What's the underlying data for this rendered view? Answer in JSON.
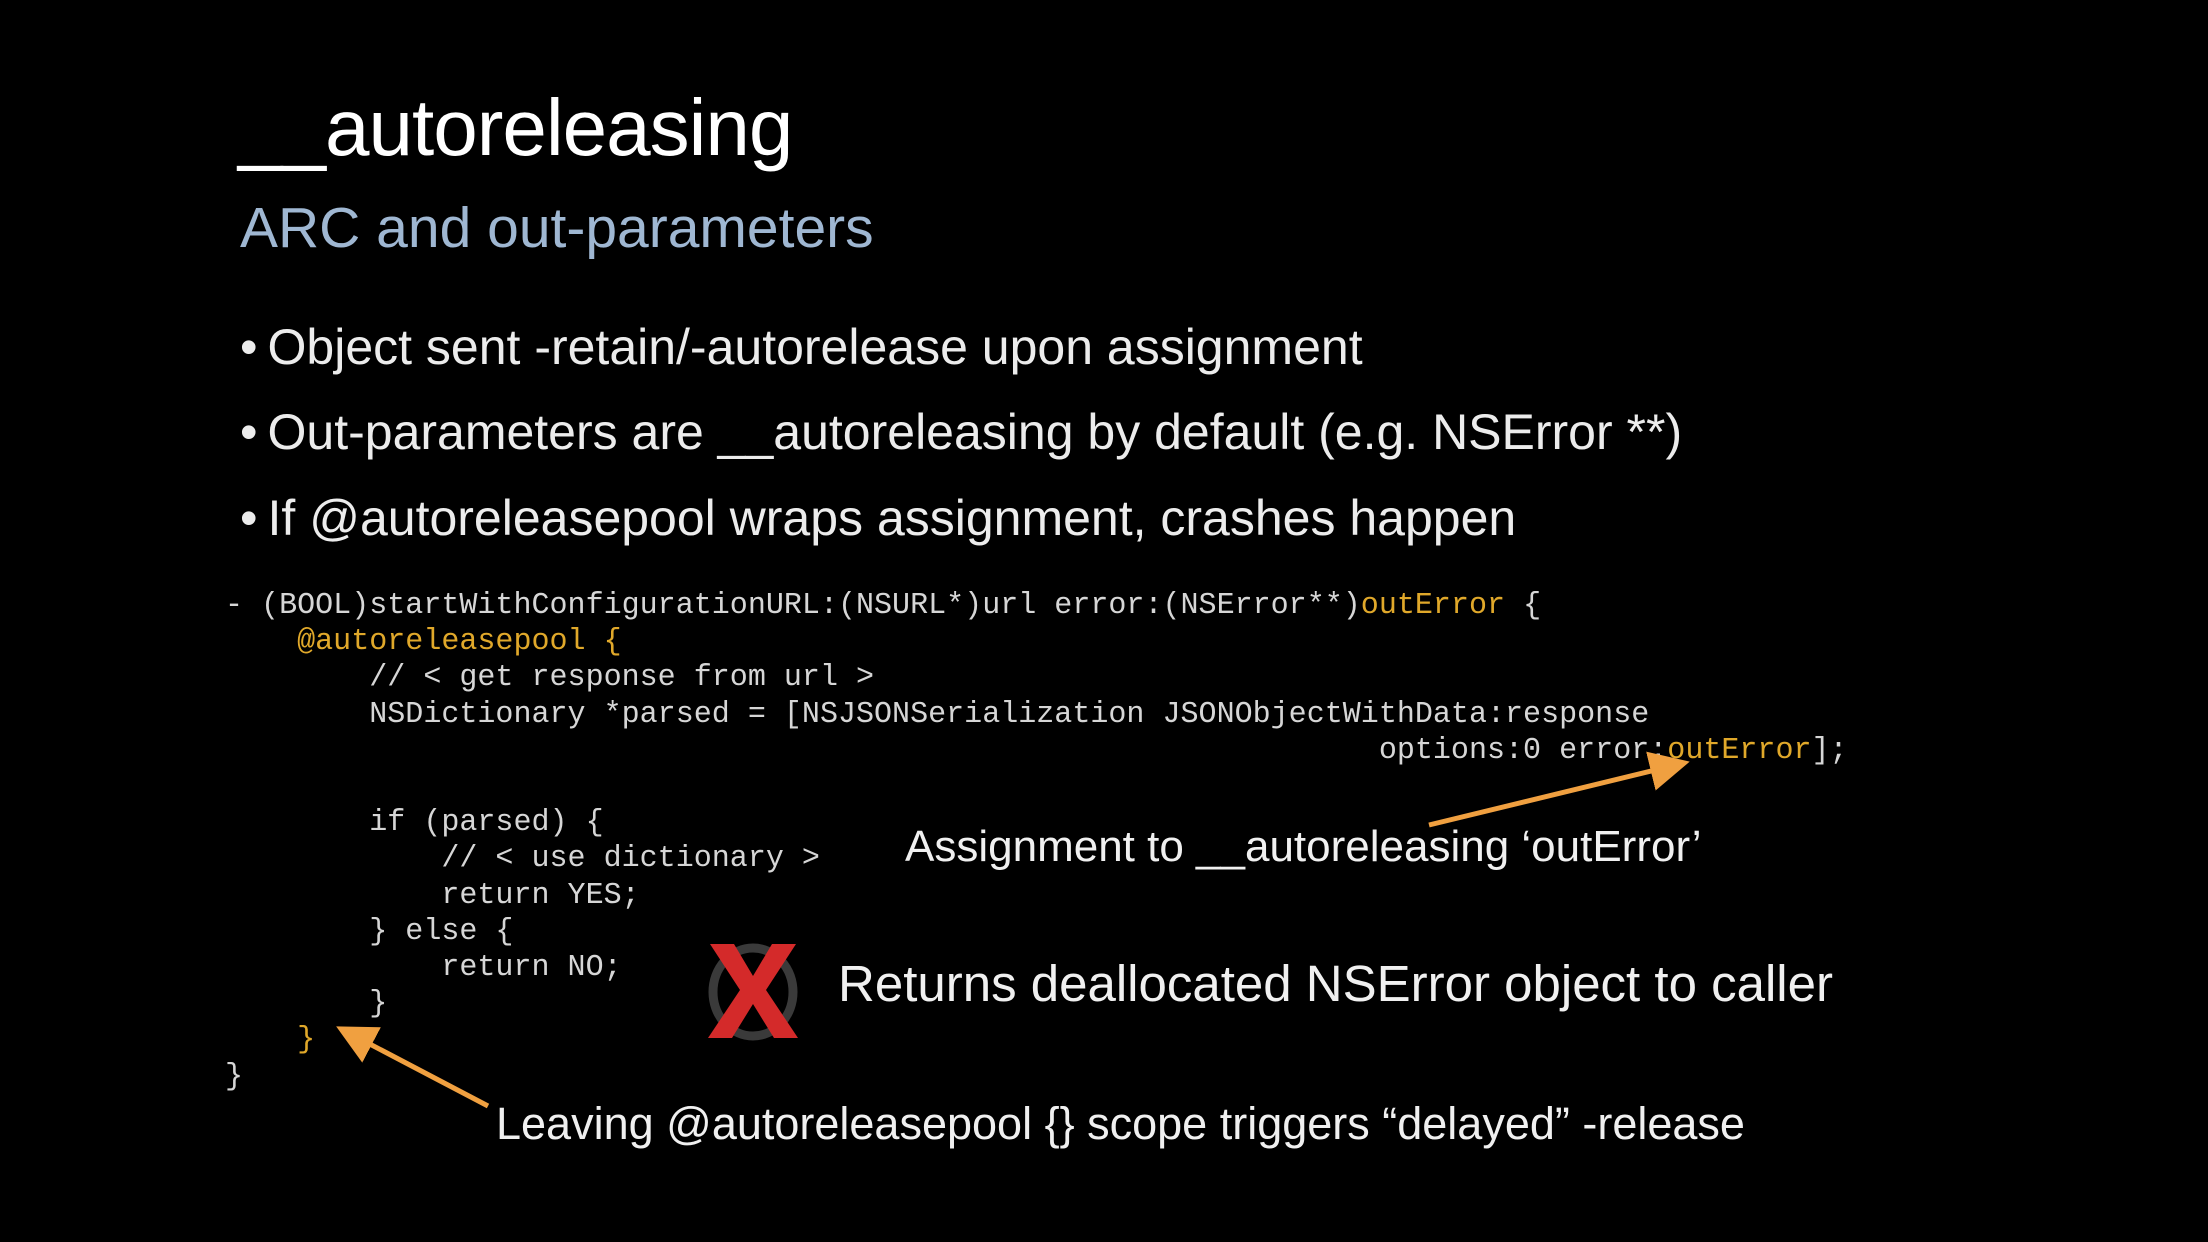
{
  "slide": {
    "title": "__autoreleasing",
    "subtitle": "ARC and out-parameters",
    "bullets": [
      "Object sent -retain/-autorelease upon assignment",
      "Out-parameters are __autoreleasing by default (e.g. NSError **)",
      "If @autoreleasepool wraps assignment, crashes happen"
    ],
    "code": {
      "l1a": "- (BOOL)startWithConfigurationURL:(NSURL*)url error:(NSError**)",
      "l1b": "outError",
      "l1c": " {",
      "l2": "    @autoreleasepool {",
      "l3": "        // < get response from url >",
      "l4": "        NSDictionary *parsed = [NSJSONSerialization JSONObjectWithData:response",
      "l5a": "                                                                options:0 error:",
      "l5b": "outError",
      "l5c": "];",
      "l6": "",
      "l7": "        if (parsed) {",
      "l8": "            // < use dictionary >",
      "l9": "            return YES;",
      "l10": "        } else {",
      "l11": "            return NO;",
      "l12": "        }",
      "l13": "    }",
      "l14": "}"
    },
    "annotations": {
      "assignment": "Assignment to __autoreleasing ‘outError’",
      "returns": "Returns deallocated NSError object to caller",
      "leaving": "Leaving @autoreleasepool {} scope triggers “delayed” -release"
    },
    "colors": {
      "background": "#000000",
      "accent": "#e0a82a",
      "arrow": "#f0a040",
      "x_icon": "#d42a2a",
      "subtitle": "#9fb7d2"
    },
    "icons": {
      "x": "x-mark-icon"
    }
  }
}
